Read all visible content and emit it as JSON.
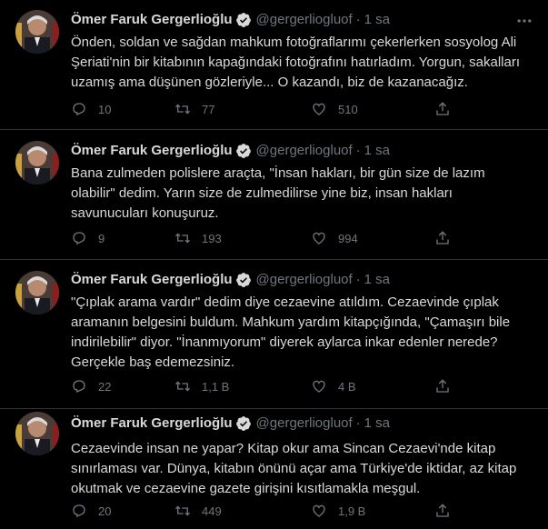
{
  "colors": {
    "background": "#000000",
    "text": "#d9d9d9",
    "muted": "#6e767d",
    "divider": "#2f3336",
    "verified": "#d9d9d9"
  },
  "tweets": [
    {
      "name": "Ömer Faruk Gergerlioğlu",
      "handle": "@gergerliogluof",
      "dot": "·",
      "time": "1 sa",
      "text": "Önden, soldan ve sağdan mahkum fotoğraflarımı çekerlerken sosyolog Ali\nŞeriati'nin bir kitabının kapağındaki fotoğrafını hatırladım. Yorgun, sakalları\nuzamış ama düşünen gözleriyle... O kazandı, biz de kazanacağız.",
      "replies": "10",
      "retweets": "77",
      "likes": "510",
      "icons": [
        "verified-icon",
        "more-icon",
        "reply-icon",
        "retweet-icon",
        "like-icon",
        "share-icon"
      ]
    },
    {
      "name": "Ömer Faruk Gergerlioğlu",
      "handle": "@gergerliogluof",
      "dot": "·",
      "time": "1 sa",
      "text": "Bana zulmeden polislere araçta, \"İnsan hakları, bir gün size de lazım\nolabilir\" dedim. Yarın size de zulmedilirse yine biz, insan hakları\nsavunucuları konuşuruz.",
      "replies": "9",
      "retweets": "193",
      "likes": "994"
    },
    {
      "name": "Ömer Faruk Gergerlioğlu",
      "handle": "@gergerliogluof",
      "dot": "·",
      "time": "1 sa",
      "text": "\"Çıplak arama vardır\" dedim diye cezaevine atıldım. Cezaevinde çıplak\naramanın belgesini buldum. Mahkum yardım kitapçığında, \"Çamaşırı bile\nindirilebilir\" diyor. \"İnanmıyorum\" diyerek aylarca inkar edenler nerede?\nGerçekle baş edemezsiniz.",
      "replies": "22",
      "retweets": "1,1 B",
      "likes": "4 B"
    },
    {
      "name": "Ömer Faruk Gergerlioğlu",
      "handle": "@gergerliogluof",
      "dot": "·",
      "time": "1 sa",
      "text": "Cezaevinde insan ne yapar? Kitap okur ama Sincan Cezaevi'nde kitap\nsınırlaması var. Dünya, kitabın önünü açar ama Türkiye'de iktidar, az kitap\nokutmak ve cezaevine gazete girişini kısıtlamakla meşgul.",
      "replies": "20",
      "retweets": "449",
      "likes": "1,9 B"
    }
  ]
}
